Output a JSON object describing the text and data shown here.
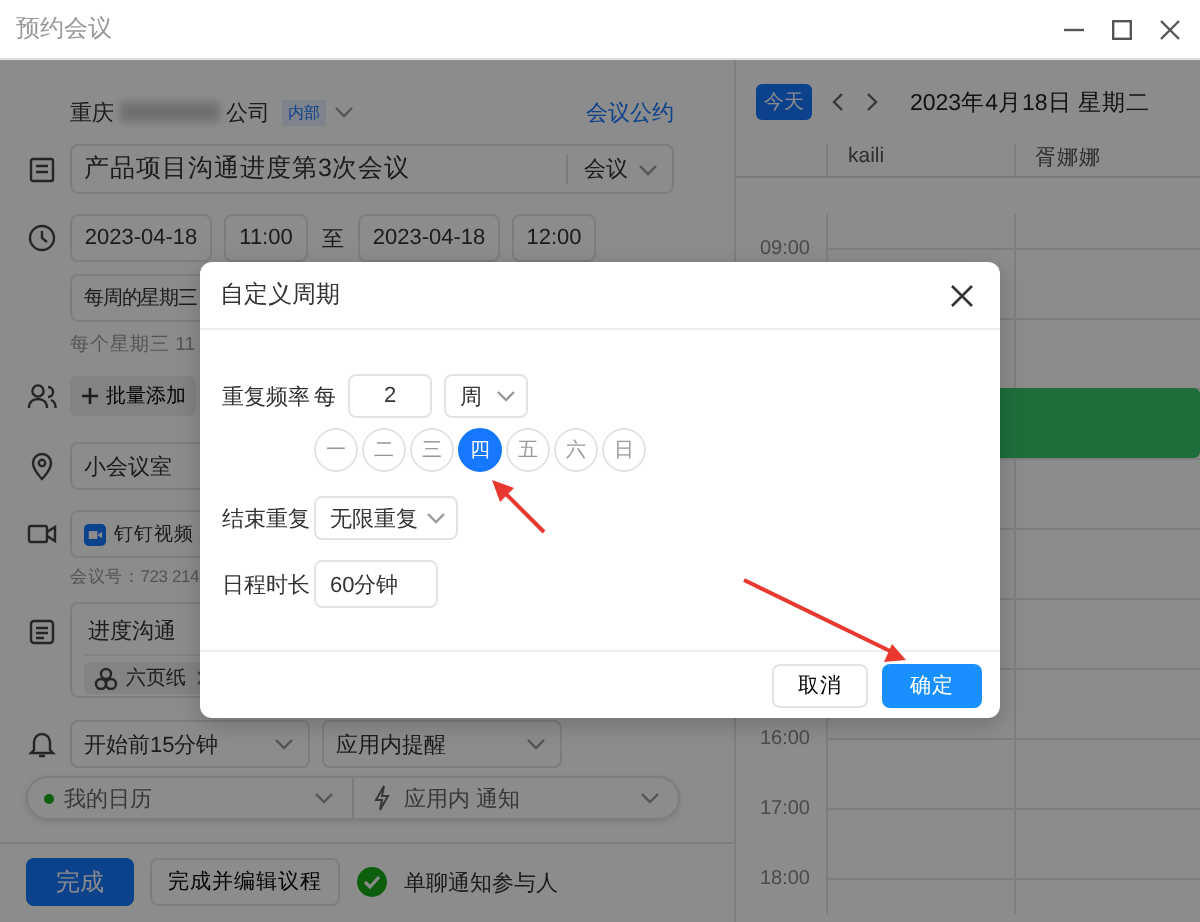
{
  "window": {
    "title": "预约会议"
  },
  "form": {
    "org": {
      "prefix": "重庆",
      "suffix": "公司",
      "badge": "内部",
      "link": "会议公约"
    },
    "title": {
      "value": "产品项目沟通进度第3次会议",
      "type": "会议"
    },
    "time": {
      "start_date": "2023-04-18",
      "start_time": "11:00",
      "separator": "至",
      "end_date": "2023-04-18",
      "end_time": "12:00"
    },
    "repeat": {
      "value": "每周的星期三",
      "hint": "每个星期三 11"
    },
    "attendees": {
      "add_button": "批量添加"
    },
    "location": {
      "value": "小会议室"
    },
    "video": {
      "value": "钉钉视频",
      "hint": "会议号：723 214"
    },
    "notes": {
      "value": "进度沟通",
      "attachment": "六页纸"
    },
    "reminder": {
      "time": "开始前15分钟",
      "method": "应用内提醒"
    },
    "calendar": {
      "name": "我的日历",
      "notify": "应用内 通知"
    },
    "actions": {
      "done": "完成",
      "done_edit": "完成并编辑议程",
      "notify_checked": true,
      "notify_label": "单聊通知参与人"
    }
  },
  "calendar_view": {
    "today": "今天",
    "date": "2023年4月18日 星期二",
    "columns": [
      "kaili",
      "胥娜娜"
    ],
    "rows": [
      {
        "time": "09:00",
        "event": false
      },
      {
        "event": false
      },
      {
        "event": true
      },
      {
        "event": false
      },
      {
        "event": false
      },
      {
        "event": false
      },
      {
        "event": false
      },
      {
        "time": "16:00",
        "event": false
      },
      {
        "time": "17:00",
        "event": false
      },
      {
        "time": "18:00",
        "event": false
      }
    ]
  },
  "dialog": {
    "title": "自定义周期",
    "frequency_label": "重复频率",
    "every": "每",
    "interval": "2",
    "unit": "周",
    "weekdays": [
      {
        "label": "一",
        "selected": false
      },
      {
        "label": "二",
        "selected": false
      },
      {
        "label": "三",
        "selected": false
      },
      {
        "label": "四",
        "selected": true
      },
      {
        "label": "五",
        "selected": false
      },
      {
        "label": "六",
        "selected": false
      },
      {
        "label": "日",
        "selected": false
      }
    ],
    "end_label": "结束重复",
    "end_value": "无限重复",
    "duration_label": "日程时长",
    "duration": "60分钟",
    "cancel": "取消",
    "ok": "确定"
  }
}
